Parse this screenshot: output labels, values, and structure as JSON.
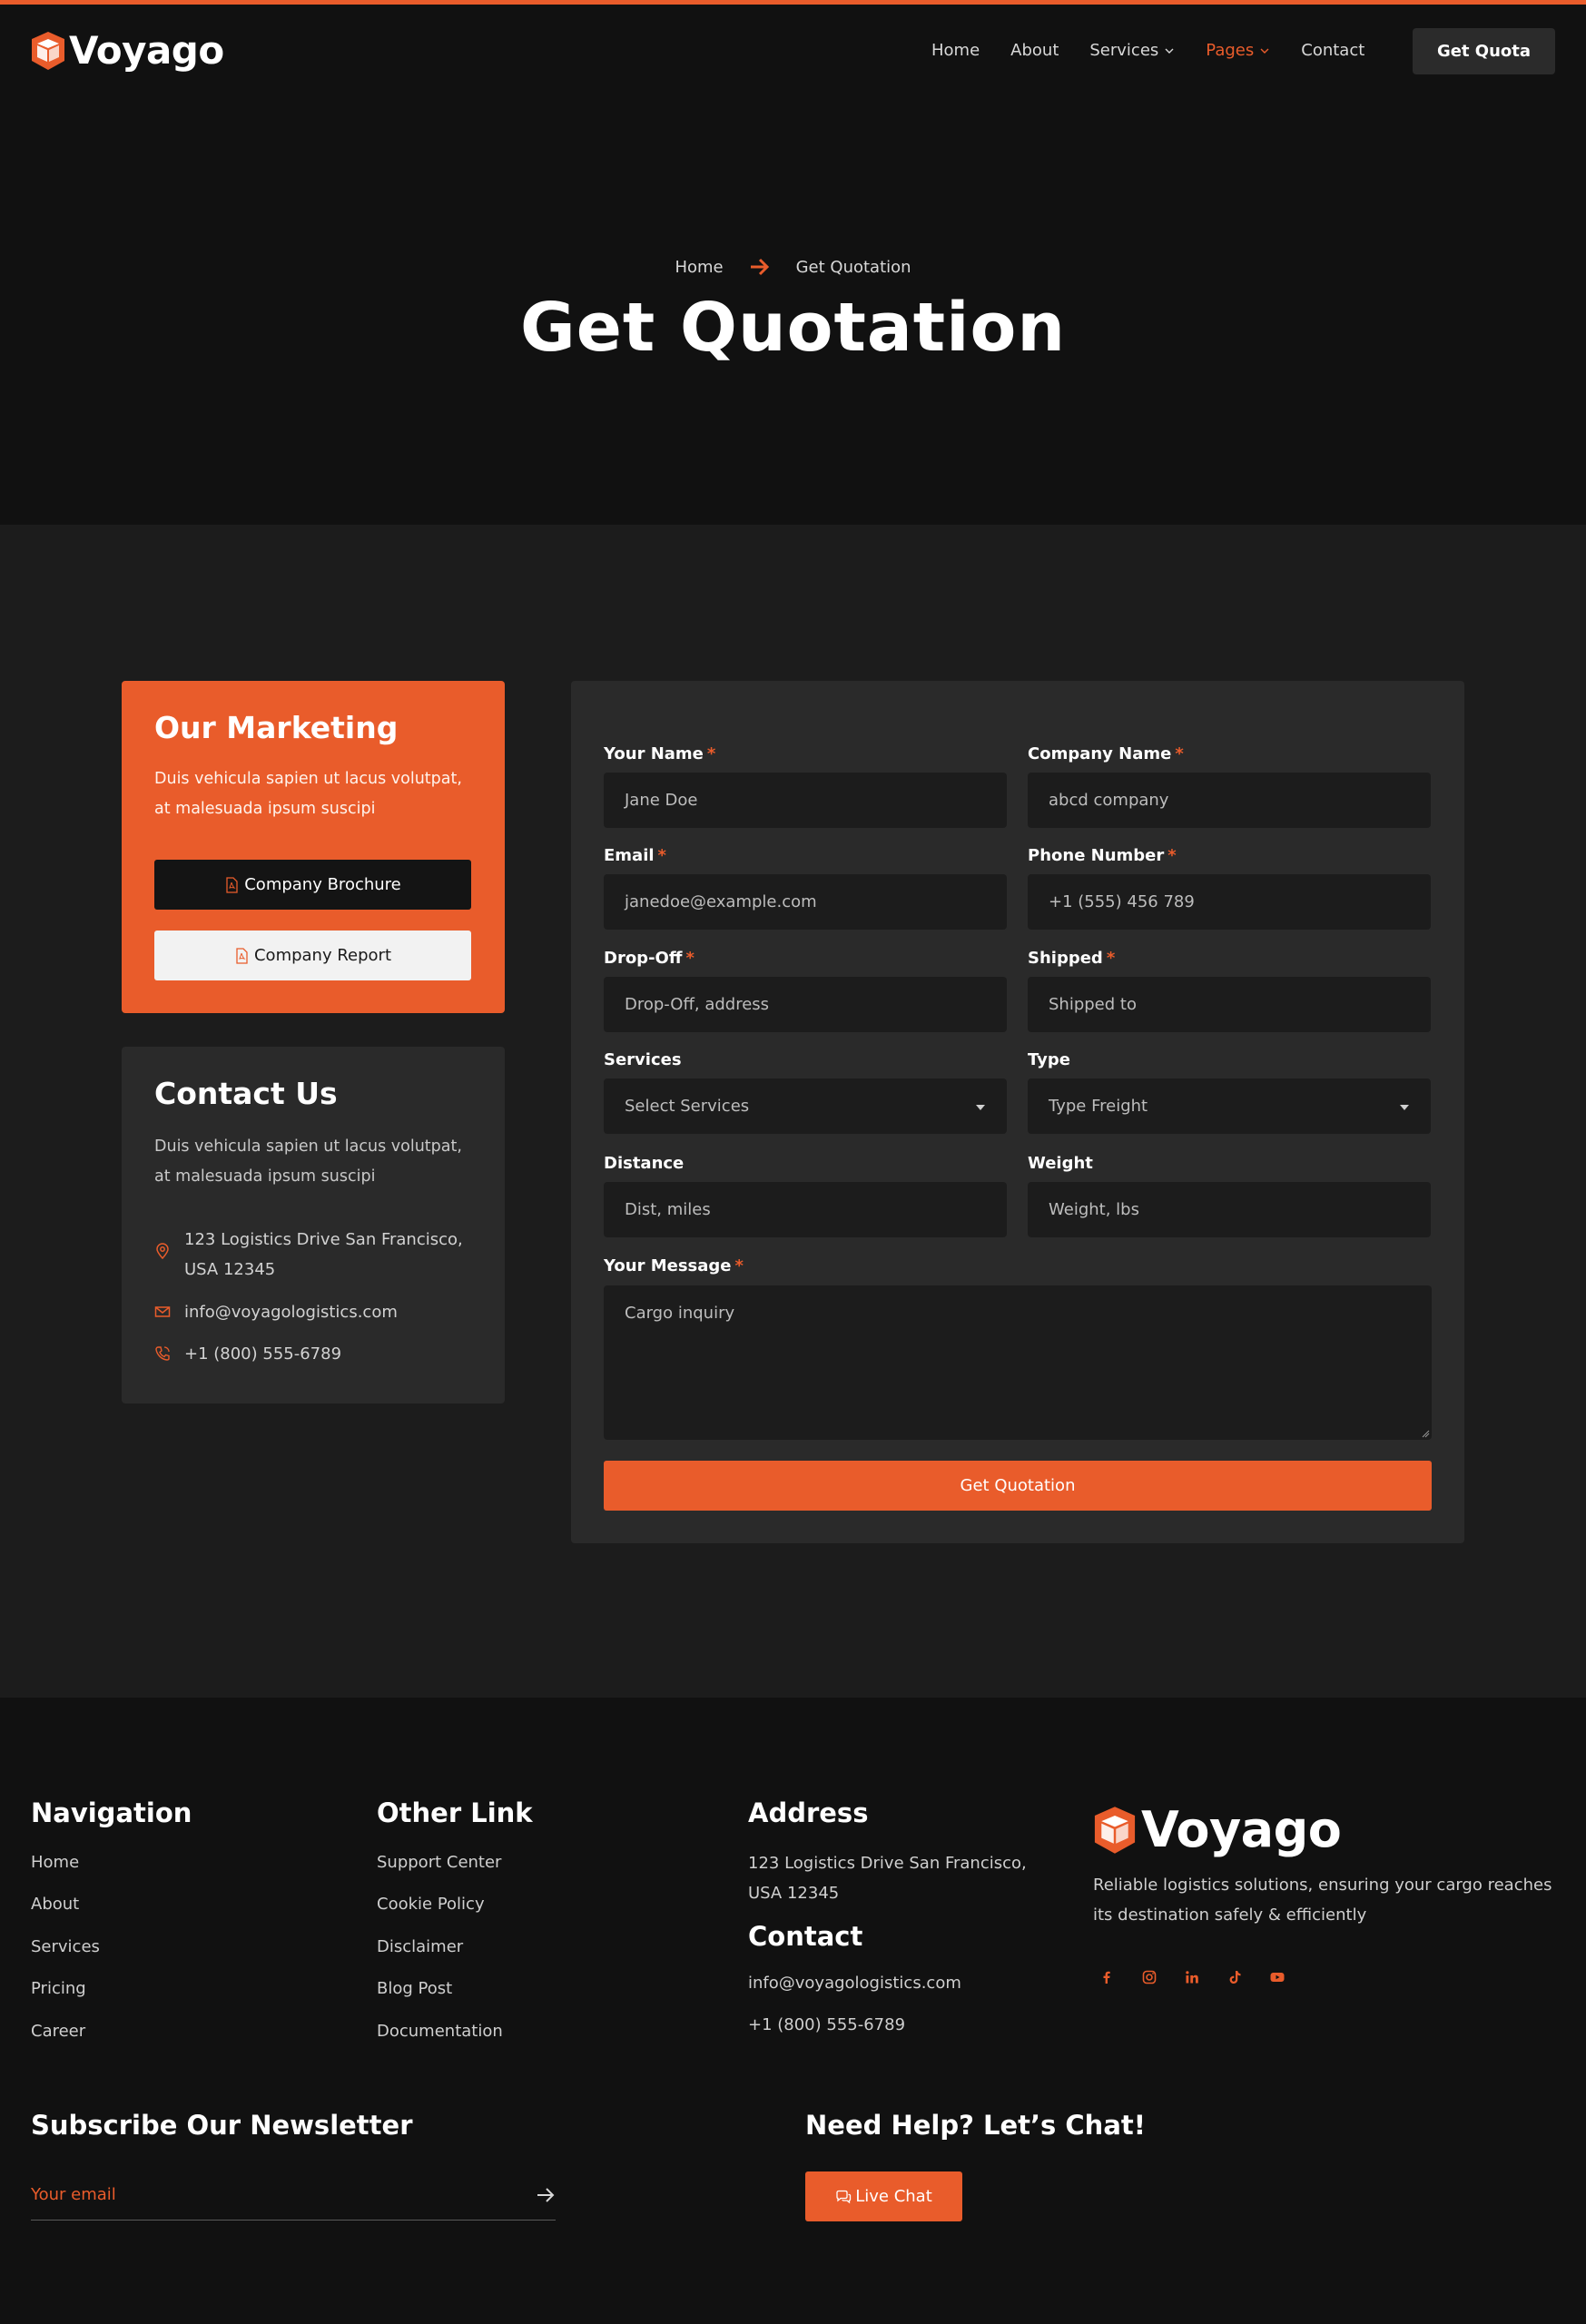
{
  "brand": {
    "name": "Voyago",
    "accent": "#e95c2b"
  },
  "nav": {
    "items": [
      {
        "label": "Home",
        "dropdown": false
      },
      {
        "label": "About",
        "dropdown": false
      },
      {
        "label": "Services",
        "dropdown": true
      },
      {
        "label": "Pages",
        "dropdown": true,
        "active": true
      },
      {
        "label": "Contact",
        "dropdown": false
      }
    ],
    "cta": "Get Quota"
  },
  "hero": {
    "breadcrumb": [
      "Home",
      "Get Quotation"
    ],
    "title": "Get Quotation"
  },
  "marketing": {
    "title": "Our Marketing",
    "text": "Duis vehicula sapien ut lacus volutpat, at malesuada ipsum suscipi",
    "buttons": [
      "Company Brochure",
      "Company Report"
    ]
  },
  "contact": {
    "title": "Contact Us",
    "text": "Duis vehicula sapien ut lacus volutpat, at malesuada ipsum suscipi",
    "address": "123 Logistics Drive San Francisco, USA 12345",
    "email": "info@voyagologistics.com",
    "phone": "+1 (800) 555-6789"
  },
  "form": {
    "fields": [
      {
        "label": "Your Name",
        "required": true,
        "placeholder": "Jane Doe",
        "kind": "input"
      },
      {
        "label": "Company Name",
        "required": true,
        "placeholder": "abcd company",
        "kind": "input"
      },
      {
        "label": "Email",
        "required": true,
        "placeholder": "janedoe@example.com",
        "kind": "input"
      },
      {
        "label": "Phone Number",
        "required": true,
        "placeholder": "+1 (555) 456 789",
        "kind": "input"
      },
      {
        "label": "Drop-Off",
        "required": true,
        "placeholder": "Drop-Off, address",
        "kind": "input"
      },
      {
        "label": "Shipped",
        "required": true,
        "placeholder": "Shipped to",
        "kind": "input"
      },
      {
        "label": "Services",
        "required": false,
        "placeholder": "Select Services",
        "kind": "select"
      },
      {
        "label": "Type",
        "required": false,
        "placeholder": "Type Freight",
        "kind": "select"
      },
      {
        "label": "Distance",
        "required": false,
        "placeholder": "Dist, miles",
        "kind": "input"
      },
      {
        "label": "Weight",
        "required": false,
        "placeholder": "Weight, lbs",
        "kind": "input"
      }
    ],
    "message": {
      "label": "Your Message",
      "required": true,
      "placeholder": "Cargo inquiry"
    },
    "submit": "Get Quotation",
    "required_mark": "*"
  },
  "footer": {
    "navigation": {
      "title": "Navigation",
      "links": [
        "Home",
        "About",
        "Services",
        "Pricing",
        "Career"
      ]
    },
    "other": {
      "title": "Other Link",
      "links": [
        "Support Center",
        "Cookie Policy",
        "Disclaimer",
        "Blog Post",
        "Documentation"
      ]
    },
    "address": {
      "title": "Address",
      "text": "123 Logistics Drive San Francisco, USA 12345"
    },
    "contact": {
      "title": "Contact",
      "email": "info@voyagologistics.com",
      "phone": "+1 (800) 555-6789"
    },
    "about": "Reliable logistics solutions, ensuring your cargo reaches its destination safely & efficiently",
    "social": [
      "facebook-icon",
      "instagram-icon",
      "linkedin-icon",
      "tiktok-icon",
      "youtube-icon"
    ],
    "newsletter": {
      "title": "Subscribe Our Newsletter",
      "placeholder": "Your email"
    },
    "chat": {
      "title": "Need Help? Let’s Chat!",
      "button": "Live Chat"
    }
  }
}
